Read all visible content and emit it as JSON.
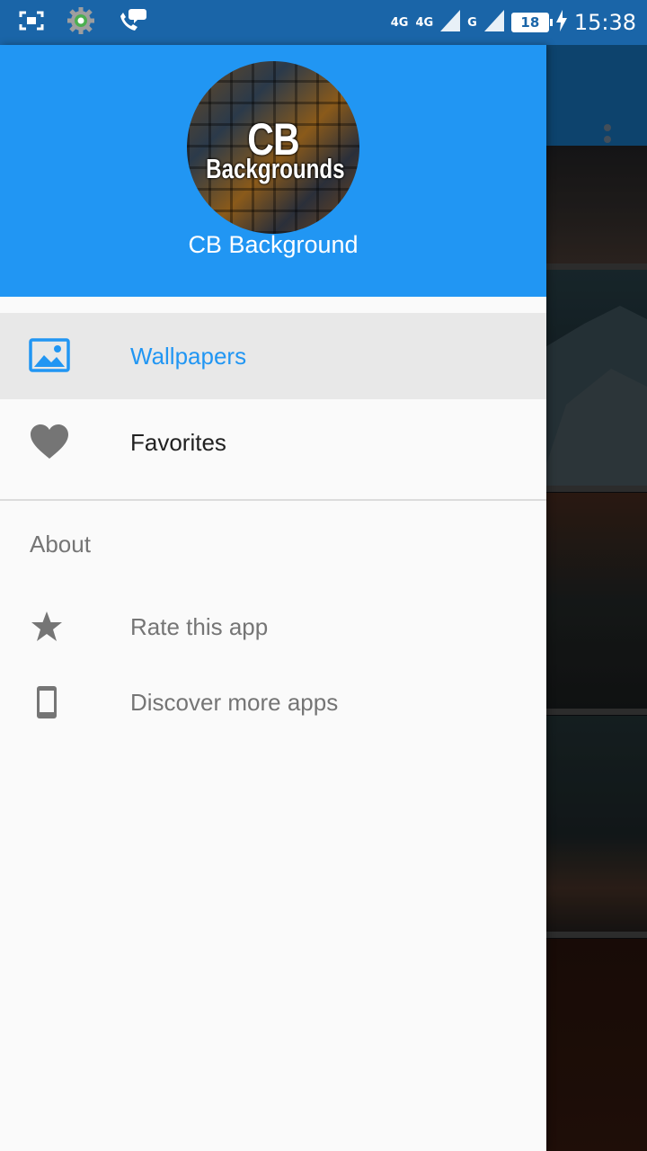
{
  "status_bar": {
    "time": "15:38",
    "battery": "18",
    "network_1": "4G",
    "network_2": "4G",
    "network_3": "G"
  },
  "drawer": {
    "logo": {
      "line1": "CB",
      "line2": "Backgrounds"
    },
    "header_title": "CB Background",
    "items": [
      {
        "label": "Wallpapers",
        "icon": "image-icon",
        "selected": true
      },
      {
        "label": "Favorites",
        "icon": "heart-icon",
        "selected": false
      }
    ],
    "section_title": "About",
    "sub_items": [
      {
        "label": "Rate this app",
        "icon": "star-icon"
      },
      {
        "label": "Discover more apps",
        "icon": "phone-icon"
      }
    ]
  },
  "colors": {
    "primary": "#2196f3",
    "status_bar": "#1a65a8",
    "selected_bg": "#e8e8e8"
  }
}
